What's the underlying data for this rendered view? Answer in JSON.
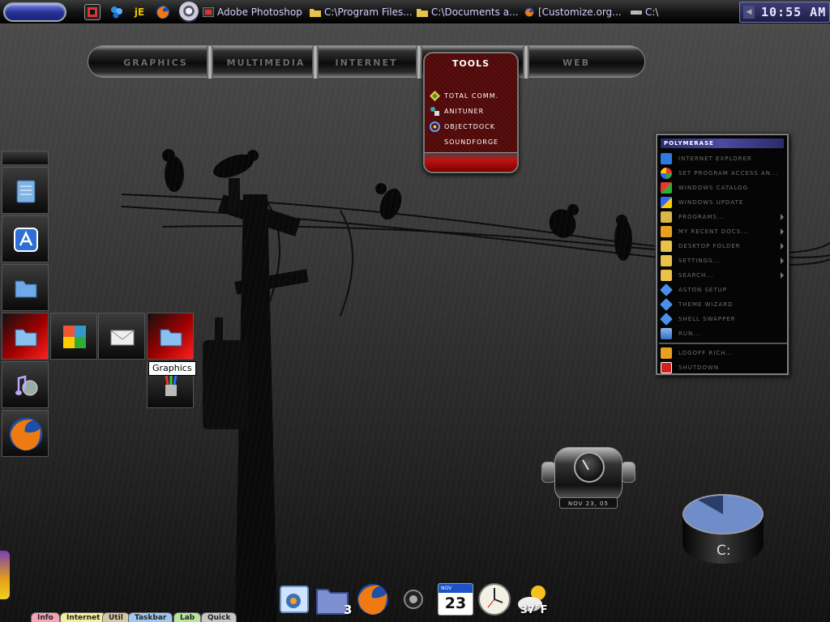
{
  "taskbar": {
    "clock": "10:55 AM",
    "quick_icons": [
      "photoshop-icon",
      "messenger-icon",
      "je-icon",
      "firefox-icon"
    ],
    "quick_je_label": "jE",
    "tasks": [
      {
        "label": "Adobe Photoshop",
        "icon": "photoshop-icon"
      },
      {
        "label": "C:\\Program Files...",
        "icon": "folder-icon"
      },
      {
        "label": "C:\\Documents a...",
        "icon": "folder-icon"
      },
      {
        "label": "[Customize.org...",
        "icon": "firefox-icon"
      },
      {
        "label": "C:\\",
        "icon": "drive-icon"
      }
    ]
  },
  "category_menu": {
    "items": [
      "GRAPHICS",
      "MULTIMEDIA",
      "INTERNET",
      "TOOLS",
      "WEB"
    ],
    "active": "TOOLS",
    "tools_items": [
      {
        "label": "TOTAL COMM.",
        "icon": "total-commander-icon"
      },
      {
        "label": "ANITUNER",
        "icon": "anituner-icon"
      },
      {
        "label": "OBJECTDOCK",
        "icon": "objectdock-icon"
      },
      {
        "label": "SOUNDFORGE",
        "icon": "soundforge-icon"
      }
    ]
  },
  "left_dock": {
    "tooltip": "Graphics",
    "tiles": [
      "notepad-icon",
      "app-icon",
      "folder-icon",
      "graphics-folder-icon",
      "music-icon",
      "firefox-icon"
    ],
    "expanded": [
      "puzzle-icon",
      "mail-icon",
      "graphics-folder-icon",
      "brushes-icon"
    ]
  },
  "start_menu": {
    "title": "POLYMERASE",
    "items": [
      {
        "label": "INTERNET EXPLORER",
        "icon": "ie-icon",
        "submenu": false
      },
      {
        "label": "SET PROGRAM ACCESS AN...",
        "icon": "program-access-icon",
        "submenu": false
      },
      {
        "label": "WINDOWS CATALOG",
        "icon": "windows-catalog-icon",
        "submenu": false
      },
      {
        "label": "WINDOWS UPDATE",
        "icon": "windows-update-icon",
        "submenu": false
      },
      {
        "label": "PROGRAMS...",
        "icon": "programs-icon",
        "submenu": true
      },
      {
        "label": "MY RECENT DOCS...",
        "icon": "recent-docs-icon",
        "submenu": true
      },
      {
        "label": "DESKTOP FOLDER",
        "icon": "folder-icon",
        "submenu": true
      },
      {
        "label": "SETTINGS...",
        "icon": "folder-icon",
        "submenu": true
      },
      {
        "label": "SEARCH...",
        "icon": "folder-icon",
        "submenu": true
      },
      {
        "label": "ASTON SETUP",
        "icon": "aston-setup-icon",
        "submenu": false
      },
      {
        "label": "THEME WIZARD",
        "icon": "theme-wizard-icon",
        "submenu": false
      },
      {
        "label": "SHELL SWAPPER",
        "icon": "shell-swapper-icon",
        "submenu": false
      },
      {
        "label": "RUN...",
        "icon": "run-icon",
        "submenu": false
      }
    ],
    "bottom_items": [
      {
        "label": "LOGOFF RICH...",
        "icon": "logoff-icon"
      },
      {
        "label": "SHUTDOWN",
        "icon": "shutdown-icon"
      }
    ]
  },
  "clock_widget": {
    "date": "NOV 23, 05"
  },
  "drive_widget": {
    "label": "C:",
    "used_fraction": 0.83
  },
  "bottom_dock": {
    "items": [
      "pictures-icon",
      "folder-icon",
      "firefox-icon",
      "center-orb-icon",
      "calendar-icon",
      "clock-icon",
      "weather-icon"
    ],
    "folder_count": "3",
    "calendar_month": "NOV",
    "calendar_day": "23",
    "temperature": "37°F"
  },
  "bottom_tabs": [
    {
      "label": "Info",
      "color": "#f5a3b5"
    },
    {
      "label": "Internet",
      "color": "#f3ef9a"
    },
    {
      "label": "Util",
      "color": "#d7c7a6"
    },
    {
      "label": "Taskbar",
      "color": "#9fc7ef"
    },
    {
      "label": "Lab",
      "color": "#b9e59a"
    },
    {
      "label": "Quick",
      "color": "#c6c6c6"
    }
  ]
}
